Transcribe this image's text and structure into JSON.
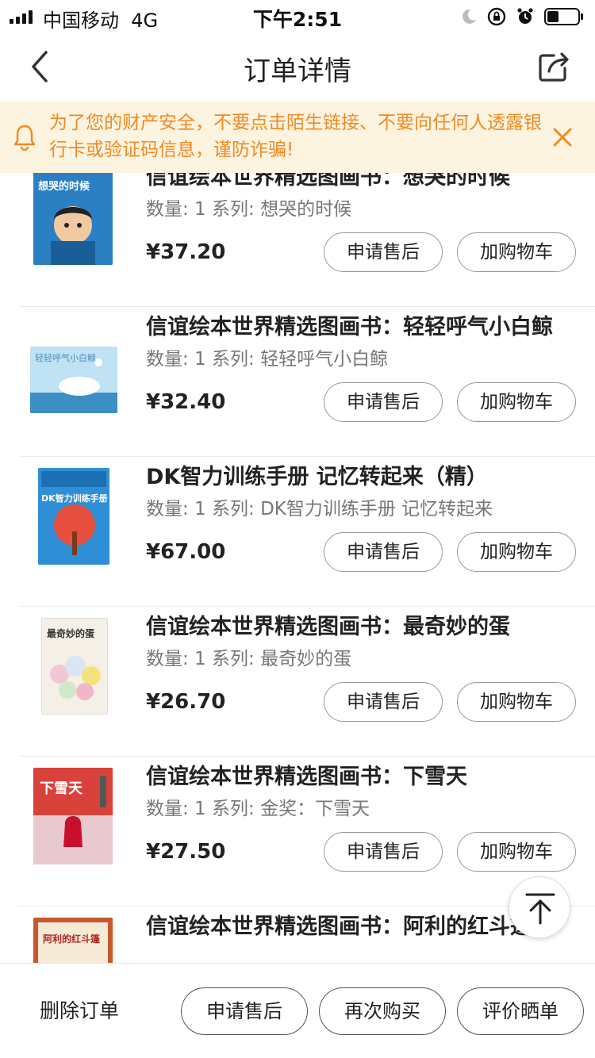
{
  "status_bar": {
    "carrier": "中国移动",
    "network": "4G",
    "time": "下午2:51"
  },
  "nav": {
    "title": "订单详情",
    "back_icon": "chevron-left-icon",
    "share_icon": "share-icon"
  },
  "notice": {
    "text": "为了您的财产安全，不要点击陌生链接、不要向任何人透露银行卡或验证码信息，谨防诈骗!",
    "color": "#f08a24",
    "background": "#fdf4e0"
  },
  "items": [
    {
      "title": "信谊绘本世界精选图画书：想哭的时候",
      "meta": "数量: 1 系列: 想哭的时候",
      "price": "¥37.20",
      "cover_text": "想哭的时候",
      "cover_color": "#2b7fc2"
    },
    {
      "title": "信谊绘本世界精选图画书：轻轻呼气小白鲸",
      "meta": "数量: 1 系列: 轻轻呼气小白鲸",
      "price": "¥32.40",
      "cover_text": "轻轻呼气小白鲸",
      "cover_color": "#9fd0ec"
    },
    {
      "title": "DK智力训练手册 记忆转起来（精）",
      "meta": "数量: 1 系列: DK智力训练手册 记忆转起来",
      "price": "¥67.00",
      "cover_text": "DK智力训练手册",
      "cover_color": "#2e8fd6"
    },
    {
      "title": "信谊绘本世界精选图画书：最奇妙的蛋",
      "meta": "数量: 1 系列: 最奇妙的蛋",
      "price": "¥26.70",
      "cover_text": "最奇妙的蛋",
      "cover_color": "#f4f0e6"
    },
    {
      "title": "信谊绘本世界精选图画书：下雪天",
      "meta": "数量: 1 系列: 金奖：下雪天",
      "price": "¥27.50",
      "cover_text": "下雪天",
      "cover_color": "#d9423a"
    },
    {
      "title": "信谊绘本世界精选图画书：阿利的红斗篷",
      "meta": "",
      "price": "",
      "cover_text": "阿利的红斗篷",
      "cover_color": "#c8572b"
    }
  ],
  "item_buttons": {
    "after_sale": "申请售后",
    "add_cart": "加购物车"
  },
  "bottom_bar": {
    "delete": "删除订单",
    "after_sale": "申请售后",
    "buy_again": "再次购买",
    "review": "评价晒单"
  }
}
